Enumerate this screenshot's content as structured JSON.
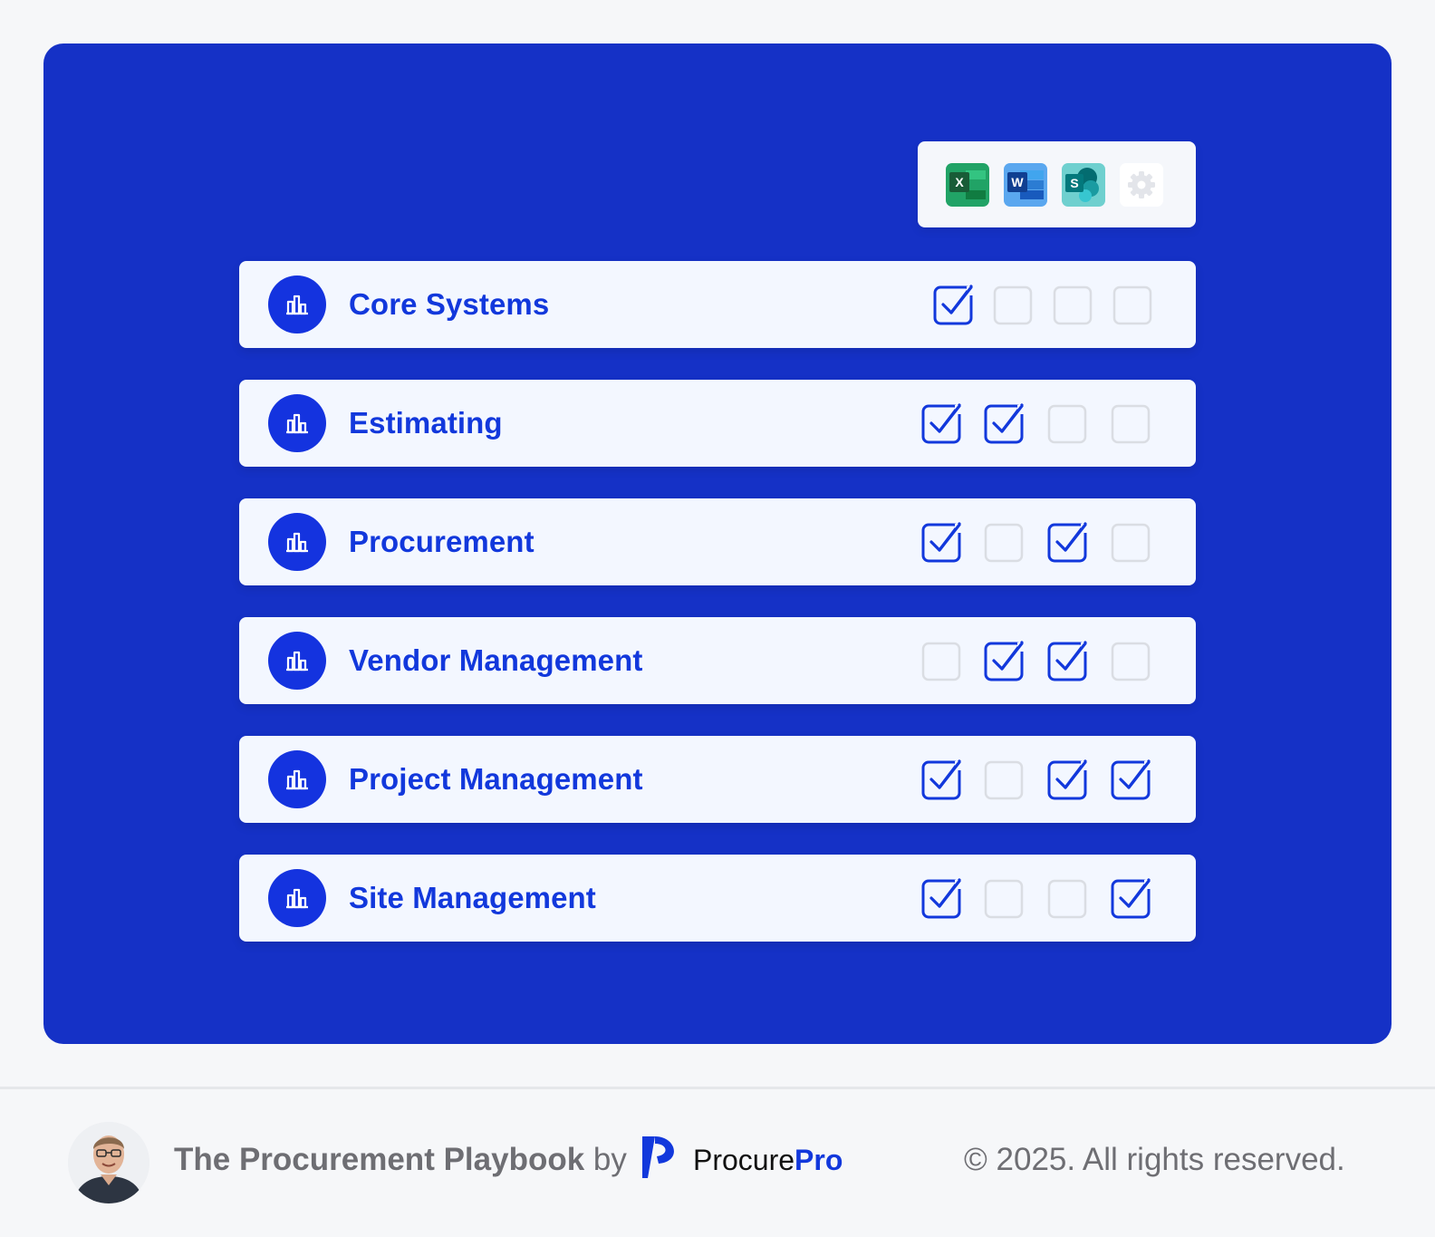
{
  "apps": [
    {
      "name": "excel-icon",
      "letter": "X",
      "color": "#21a366"
    },
    {
      "name": "word-icon",
      "letter": "W",
      "color": "#2b7cd3"
    },
    {
      "name": "sharepoint-icon",
      "letter": "S",
      "color": "#0f9aa6"
    },
    {
      "name": "gear-icon",
      "letter": "",
      "color": "#dfe2e8"
    }
  ],
  "rows": [
    {
      "label": "Core Systems",
      "checks": [
        true,
        false,
        false,
        false
      ]
    },
    {
      "label": "Estimating",
      "checks": [
        true,
        true,
        false,
        false
      ]
    },
    {
      "label": "Procurement",
      "checks": [
        true,
        false,
        true,
        false
      ]
    },
    {
      "label": "Vendor Management",
      "checks": [
        false,
        true,
        true,
        false
      ]
    },
    {
      "label": "Project Management",
      "checks": [
        true,
        false,
        true,
        true
      ]
    },
    {
      "label": "Site Management",
      "checks": [
        true,
        false,
        false,
        true
      ]
    }
  ],
  "footer": {
    "title": "The Procurement Playbook",
    "by": "by",
    "brand_prefix": "Procure",
    "brand_suffix": "Pro",
    "copyright": "© 2025. All rights reserved."
  },
  "colors": {
    "panel": "#1531c6",
    "accent": "#1238dc",
    "row_bg": "#f3f7ff",
    "page_bg": "#f6f7f9"
  }
}
